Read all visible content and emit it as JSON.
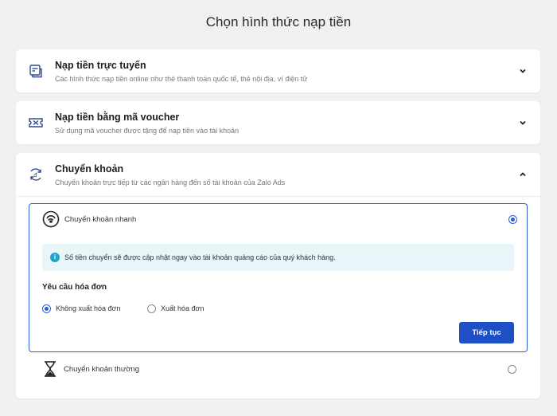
{
  "page_title": "Chọn hình thức nạp tiền",
  "methods": [
    {
      "title": "Nạp tiền trực tuyến",
      "desc": "Các hình thức nạp tiền online như thẻ thanh toán quốc tế, thẻ nội địa, ví điện tử",
      "icon": "online-payment-icon",
      "expanded": false
    },
    {
      "title": "Nạp tiền bằng mã voucher",
      "desc": "Sử dụng mã voucher được tặng để nạp tiền vào tài khoản",
      "icon": "voucher-icon",
      "expanded": false
    },
    {
      "title": "Chuyển khoản",
      "desc": "Chuyển khoản trực tiếp từ các ngân hàng đến số tài khoản của Zalo Ads",
      "icon": "bank-transfer-icon",
      "expanded": true
    }
  ],
  "transfer": {
    "fast": {
      "label": "Chuyển khoản nhanh",
      "selected": true,
      "info": "Số tiền chuyển sẽ được cập nhật ngay vào tài khoản quảng cáo của quý khách hàng.",
      "invoice_title": "Yêu cầu hóa đơn",
      "invoice_options": [
        {
          "label": "Không xuất hóa đơn",
          "selected": true
        },
        {
          "label": "Xuất hóa đơn",
          "selected": false
        }
      ],
      "continue_label": "Tiếp tục"
    },
    "normal": {
      "label": "Chuyển khoản thường",
      "selected": false
    }
  },
  "colors": {
    "accent": "#1f4fc4",
    "selected_border": "#2d5bd7",
    "info_bg": "#e8f6fa",
    "info_icon": "#23a3c9",
    "page_bg": "#f0f0f3"
  }
}
